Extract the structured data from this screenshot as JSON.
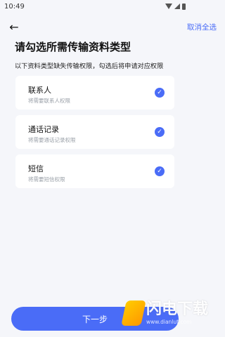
{
  "status_bar": {
    "time": "10:49"
  },
  "header": {
    "back_icon": "arrow-left-icon",
    "deselect_all_label": "取消全选"
  },
  "main": {
    "title": "请勾选所需传输资料类型",
    "subtitle": "以下资料类型缺失传输权限，勾选后将申请对应权限",
    "items": [
      {
        "title": "联系人",
        "desc": "将需要联系人权限",
        "checked": true
      },
      {
        "title": "通话记录",
        "desc": "将需要通话记录权限",
        "checked": true
      },
      {
        "title": "短信",
        "desc": "将需要短信权限",
        "checked": true
      }
    ]
  },
  "bottom": {
    "button_label": "下一步"
  },
  "watermark": {
    "main": "闪电下载",
    "url": "www.dianlut.com"
  },
  "colors": {
    "accent": "#4a6cf7",
    "background": "#f5f6fa"
  }
}
